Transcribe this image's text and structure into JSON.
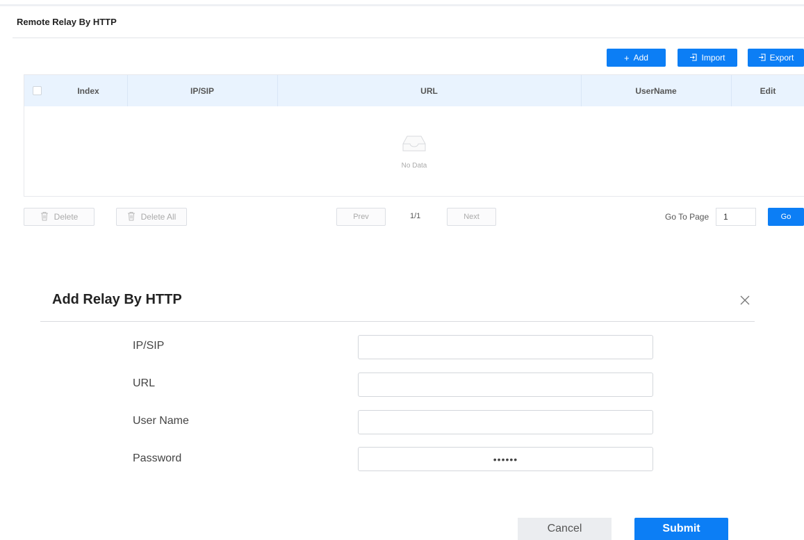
{
  "section": {
    "title": "Remote Relay By HTTP"
  },
  "toolbar": {
    "add_label": "Add",
    "import_label": "Import",
    "export_label": "Export",
    "add_icon": "plus-icon",
    "import_icon": "import-icon",
    "export_icon": "export-icon"
  },
  "table": {
    "columns": [
      "Index",
      "IP/SIP",
      "URL",
      "UserName",
      "Edit"
    ],
    "rows": [],
    "empty_text": "No Data",
    "empty_icon": "inbox-empty-icon"
  },
  "pagination": {
    "delete_label": "Delete",
    "delete_all_label": "Delete All",
    "prev_label": "Prev",
    "page_info": "1/1",
    "next_label": "Next",
    "goto_label": "Go To Page",
    "goto_value": "1",
    "go_label": "Go"
  },
  "dialog": {
    "title": "Add Relay By HTTP",
    "close_icon": "close-icon",
    "fields": [
      {
        "label": "IP/SIP",
        "value": ""
      },
      {
        "label": "URL",
        "value": ""
      },
      {
        "label": "User Name",
        "value": ""
      },
      {
        "label": "Password",
        "value": "••••••"
      }
    ],
    "cancel_label": "Cancel",
    "submit_label": "Submit"
  },
  "colors": {
    "accent": "#0c7ef5",
    "table_header_bg": "#e9f3fe"
  }
}
